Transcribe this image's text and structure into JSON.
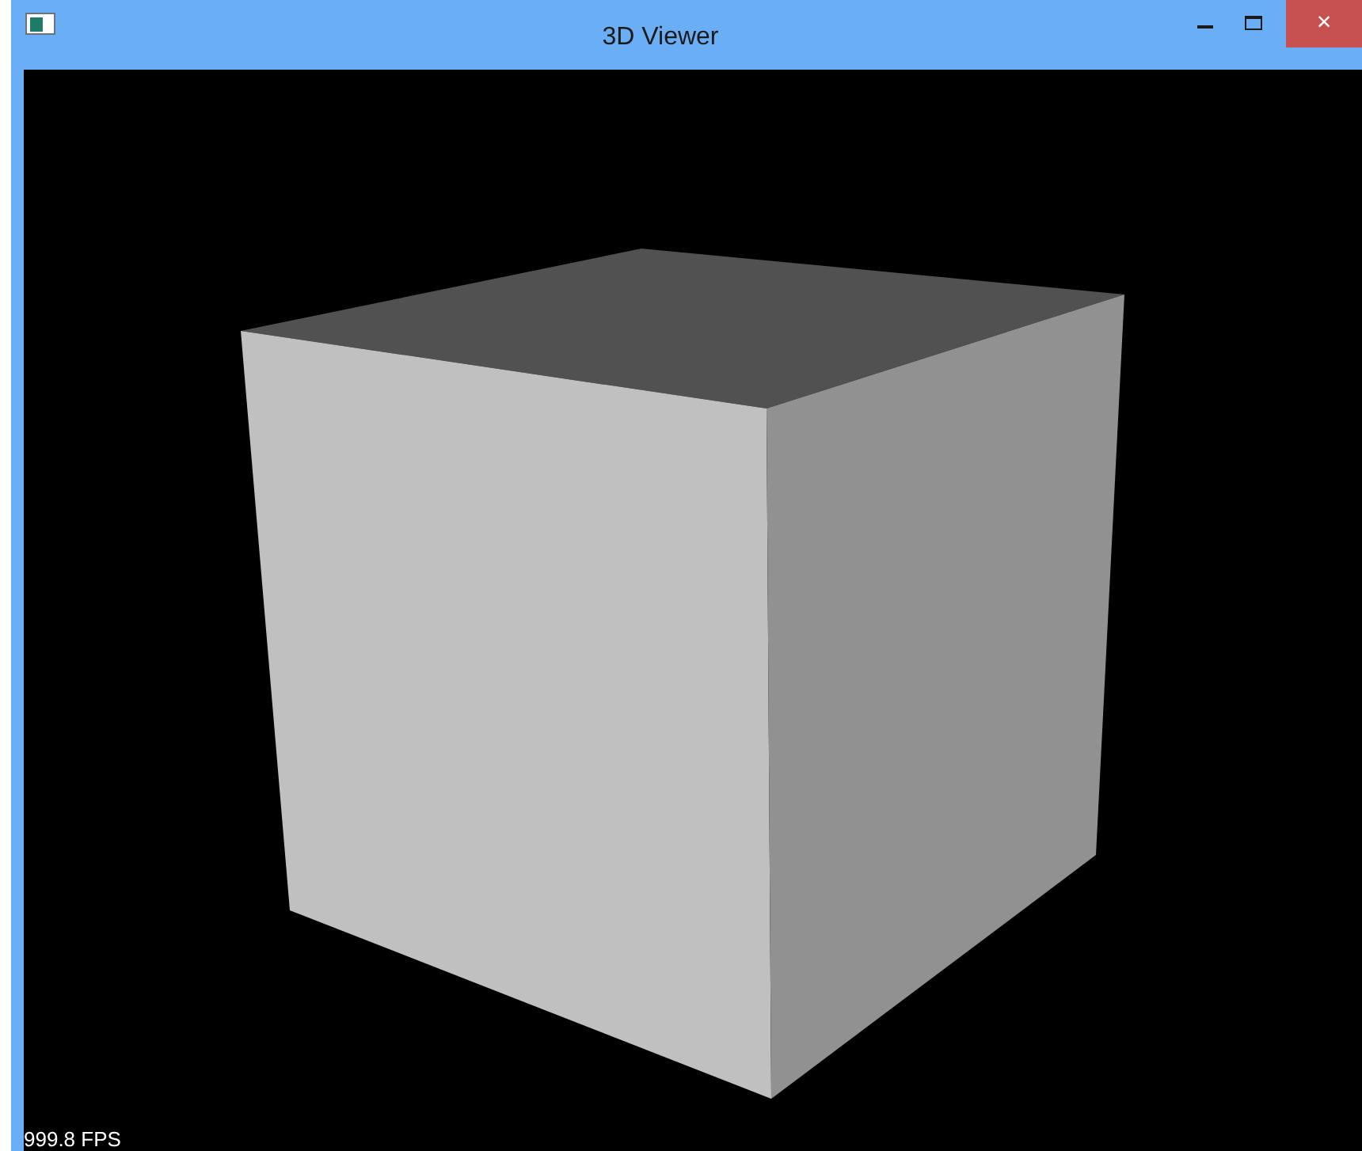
{
  "window": {
    "title": "3D Viewer",
    "close": "×"
  },
  "viewport": {
    "fps": "999.8 FPS"
  }
}
